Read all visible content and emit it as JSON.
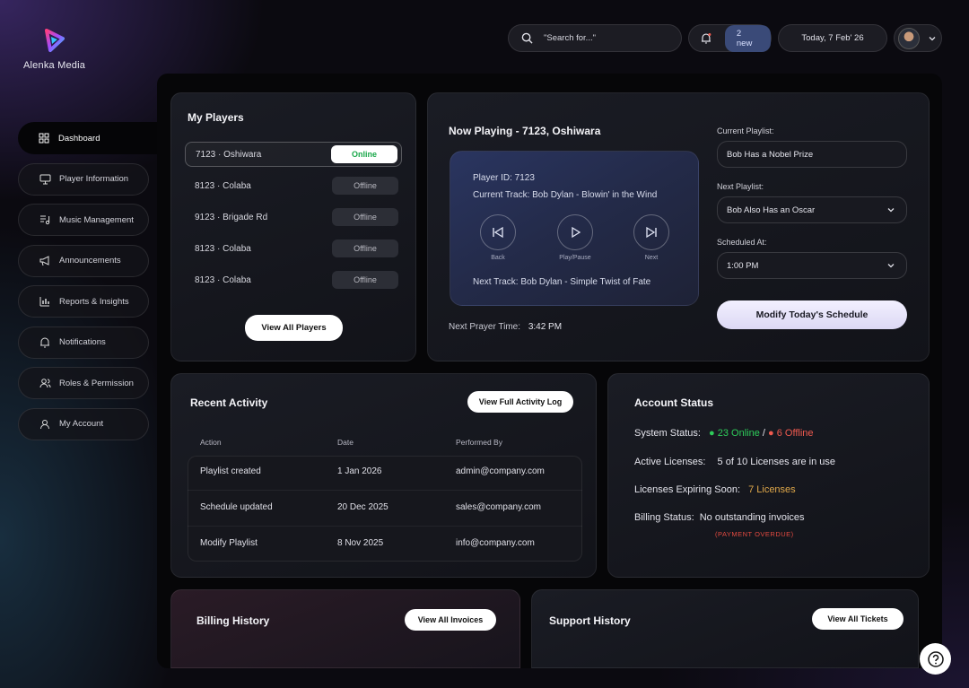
{
  "brand": {
    "name": "Alenka Media"
  },
  "header": {
    "search_placeholder": "\"Search for...\"",
    "notifications_badge": "2 new",
    "date": "Today, 7 Feb' 26"
  },
  "sidebar": {
    "items": [
      {
        "label": "Dashboard",
        "icon": "grid-icon",
        "active": true
      },
      {
        "label": "Player Information",
        "icon": "monitor-icon"
      },
      {
        "label": "Music Management",
        "icon": "music-list-icon"
      },
      {
        "label": "Announcements",
        "icon": "megaphone-icon"
      },
      {
        "label": "Reports & Insights",
        "icon": "bar-chart-icon"
      },
      {
        "label": "Notifications",
        "icon": "bell-icon"
      },
      {
        "label": "Roles & Permission",
        "icon": "users-icon"
      },
      {
        "label": "My Account",
        "icon": "user-icon"
      }
    ]
  },
  "players": {
    "title": "My Players",
    "rows": [
      {
        "name": "7123 · Oshiwara",
        "status": "Online"
      },
      {
        "name": "8123 · Colaba",
        "status": "Offline"
      },
      {
        "name": "9123 · Brigade Rd",
        "status": "Offline"
      },
      {
        "name": "8123 · Colaba",
        "status": "Offline"
      },
      {
        "name": "8123 · Colaba",
        "status": "Offline"
      }
    ],
    "view_all": "View All Players"
  },
  "now_playing": {
    "title": "Now Playing - 7123, Oshiwara",
    "player_id": "Player ID: 7123",
    "current_track": "Current Track: Bob Dylan - Blowin' in the Wind",
    "controls": {
      "back": "Back",
      "play_pause": "Play/Pause",
      "next": "Next"
    },
    "next_track": "Next Track: Bob Dylan - Simple Twist of Fate",
    "next_prayer_label": "Next Prayer Time:",
    "next_prayer_value": "3:42 PM",
    "current_playlist_label": "Current Playlist:",
    "current_playlist_value": "Bob Has a Nobel Prize",
    "next_playlist_label": "Next Playlist:",
    "next_playlist_value": "Bob Also Has an Oscar",
    "scheduled_label": "Scheduled At:",
    "scheduled_value": "1:00 PM",
    "modify_button": "Modify Today's Schedule"
  },
  "activity": {
    "title": "Recent Activity",
    "view_log": "View Full Activity Log",
    "headers": [
      "Action",
      "Date",
      "Performed By"
    ],
    "rows": [
      [
        "Playlist created",
        "1 Jan 2026",
        "admin@company.com"
      ],
      [
        "Schedule updated",
        "20 Dec 2025",
        "sales@company.com"
      ],
      [
        "Modify Playlist",
        "8 Nov 2025",
        "info@company.com"
      ]
    ]
  },
  "account": {
    "title": "Account Status",
    "system_label": "System Status:",
    "online": "● 23 Online",
    "sep": "/",
    "offline": "● 6 Offline",
    "licenses_label": "Active Licenses:",
    "licenses_value": "5 of 10 Licenses are in use",
    "expiring_label": "Licenses Expiring Soon:",
    "expiring_value": "7 Licenses",
    "billing_label": "Billing Status:",
    "billing_value": "No outstanding invoices",
    "overdue": "(PAYMENT OVERDUE)"
  },
  "billing": {
    "title": "Billing History",
    "button": "View All Invoices"
  },
  "support": {
    "title": "Support History",
    "button": "View All Tickets"
  },
  "colors": {
    "online": "#2ecc5a",
    "offline": "#ef5a4f",
    "expiring": "#e0a84a",
    "accent": "#3a4a78"
  }
}
